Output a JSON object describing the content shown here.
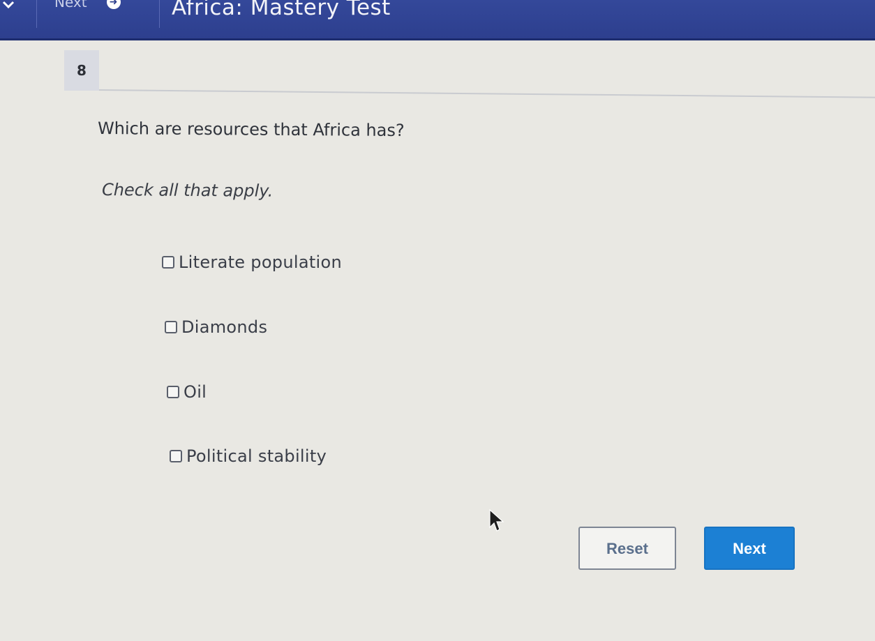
{
  "header": {
    "nav_label": "Next",
    "title": "Africa: Mastery Test",
    "chevron_icon": "chevron-down-icon",
    "next_icon": "arrow-right-circle-icon",
    "bar_color": "#2d3f8e"
  },
  "question": {
    "number": "8",
    "text": "Which are resources that Africa has?",
    "instruction": "Check all that apply."
  },
  "options": [
    {
      "label": "Literate population",
      "checked": false
    },
    {
      "label": "Diamonds",
      "checked": false
    },
    {
      "label": "Oil",
      "checked": false
    },
    {
      "label": "Political stability",
      "checked": false
    }
  ],
  "buttons": {
    "reset_label": "Reset",
    "next_label": "Next",
    "next_color": "#1c80d4"
  }
}
